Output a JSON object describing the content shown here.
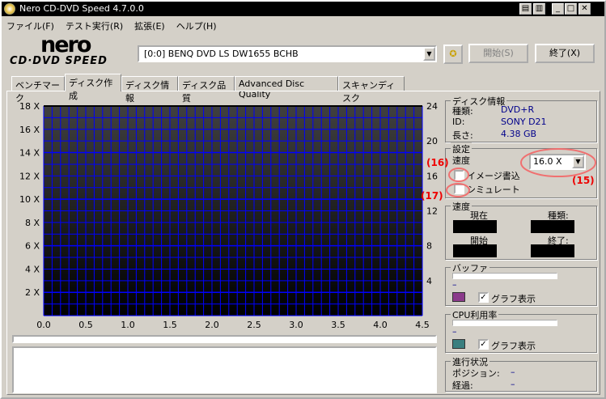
{
  "window": {
    "title": "Nero CD-DVD Speed 4.7.0.0"
  },
  "menu": [
    "ファイル(F)",
    "テスト実行(R)",
    "拡張(E)",
    "ヘルプ(H)"
  ],
  "toolbar": {
    "logo_top": "nero",
    "logo_bottom": "CD·DVD SPEED",
    "drive": "[0:0]  BENQ DVD LS DW1655 BCHB",
    "start": "開始(S)",
    "exit": "終了(X)"
  },
  "tabs": [
    {
      "label": "ベンチマーク"
    },
    {
      "label": "ディスク作成",
      "active": true
    },
    {
      "label": "ディスク情報"
    },
    {
      "label": "ディスク品質"
    },
    {
      "label": "Advanced Disc Quality"
    },
    {
      "label": "スキャンディスク"
    }
  ],
  "chart_data": {
    "type": "line",
    "series": [],
    "xlim": [
      0,
      4.5
    ],
    "ylim": [
      0,
      18
    ],
    "y2lim": [
      0,
      24
    ],
    "x_ticks": [
      "0.0",
      "0.5",
      "1.0",
      "1.5",
      "2.0",
      "2.5",
      "3.0",
      "3.5",
      "4.0",
      "4.5"
    ],
    "y_ticks": [
      "2 X",
      "4 X",
      "6 X",
      "8 X",
      "10 X",
      "12 X",
      "14 X",
      "16 X",
      "18 X"
    ],
    "y2_ticks": [
      "4",
      "8",
      "12",
      "16",
      "20",
      "24"
    ],
    "grid": true,
    "grid_color": "#0000ff"
  },
  "disc_info": {
    "title": "ディスク情報",
    "type_label": "種類:",
    "type": "DVD+R",
    "id_label": "ID:",
    "id": "SONY D21",
    "length_label": "長さ:",
    "length": "4.38 GB"
  },
  "settings": {
    "title": "設定",
    "speed_label": "速度",
    "speed": "16.0 X",
    "image_write": "イメージ書込",
    "simulate": "シミュレート"
  },
  "speed": {
    "title": "速度",
    "current": "現在",
    "type": "種類:",
    "start": "開始",
    "end": "終了:"
  },
  "buffer": {
    "title": "バッファ",
    "value": "–",
    "graph": "グラフ表示",
    "color": "#8b3a8b"
  },
  "cpu": {
    "title": "CPU利用率",
    "value": "–",
    "graph": "グラフ表示",
    "color": "#3a7f7f"
  },
  "progress": {
    "title": "進行状況",
    "position_label": "ポジション:",
    "position": "–",
    "elapsed_label": "経過:",
    "elapsed": "–"
  },
  "annotations": {
    "a15": "(15)",
    "a16": "(16)",
    "a17": "(17)"
  }
}
